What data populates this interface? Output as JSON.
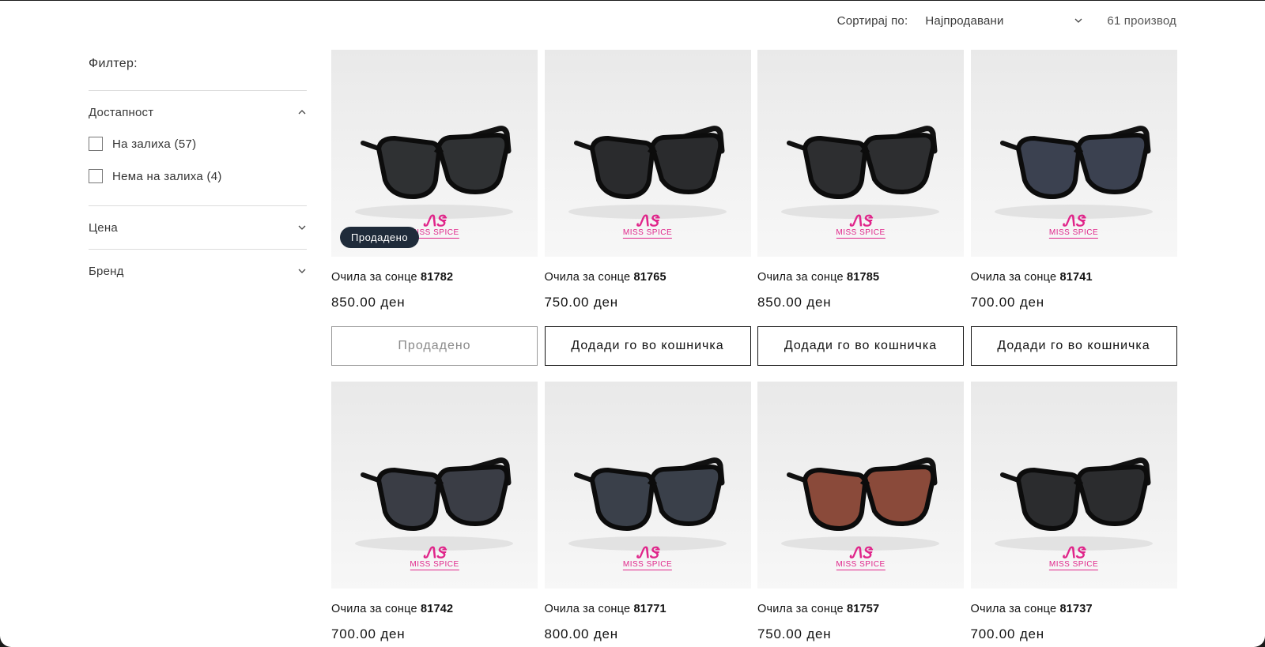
{
  "sort": {
    "label": "Сортирај по:",
    "selected": "Најпродавани",
    "count": "61 производ"
  },
  "filter": {
    "title": "Филтер:",
    "groups": [
      {
        "label": "Достапност",
        "expanded": true,
        "options": [
          {
            "label": "На залиха (57)"
          },
          {
            "label": "Нема на залиха (4)"
          }
        ]
      },
      {
        "label": "Цена",
        "expanded": false
      },
      {
        "label": "Бренд",
        "expanded": false
      }
    ]
  },
  "brand_logo": {
    "mark": "ᏁᏕ",
    "name": "MISS SPICE",
    "color": "#e0258a"
  },
  "products": [
    {
      "prefix": "Очила за сонце",
      "code": "81782",
      "price": "850.00 ден",
      "button": "Продадено",
      "sold_out": true,
      "badge": "Продадено",
      "lens": "#2f3133"
    },
    {
      "prefix": "Очила за сонце",
      "code": "81765",
      "price": "750.00 ден",
      "button": "Додади го во кошничка",
      "sold_out": false,
      "lens": "#2a2b2d"
    },
    {
      "prefix": "Очила за сонце",
      "code": "81785",
      "price": "850.00 ден",
      "button": "Додади го во кошничка",
      "sold_out": false,
      "lens": "#2d2e30"
    },
    {
      "prefix": "Очила за сонце",
      "code": "81741",
      "price": "700.00 ден",
      "button": "Додади го во кошничка",
      "sold_out": false,
      "lens": "#3b4150"
    },
    {
      "prefix": "Очила за сонце",
      "code": "81742",
      "price": "700.00 ден",
      "lens": "#3a3d45"
    },
    {
      "prefix": "Очила за сонце",
      "code": "81771",
      "price": "800.00 ден",
      "lens": "#3a404a"
    },
    {
      "prefix": "Очила за сонце",
      "code": "81757",
      "price": "750.00 ден",
      "lens": "#8a4a3a"
    },
    {
      "prefix": "Очила за сонце",
      "code": "81737",
      "price": "700.00 ден",
      "lens": "#2b2c2e"
    }
  ]
}
